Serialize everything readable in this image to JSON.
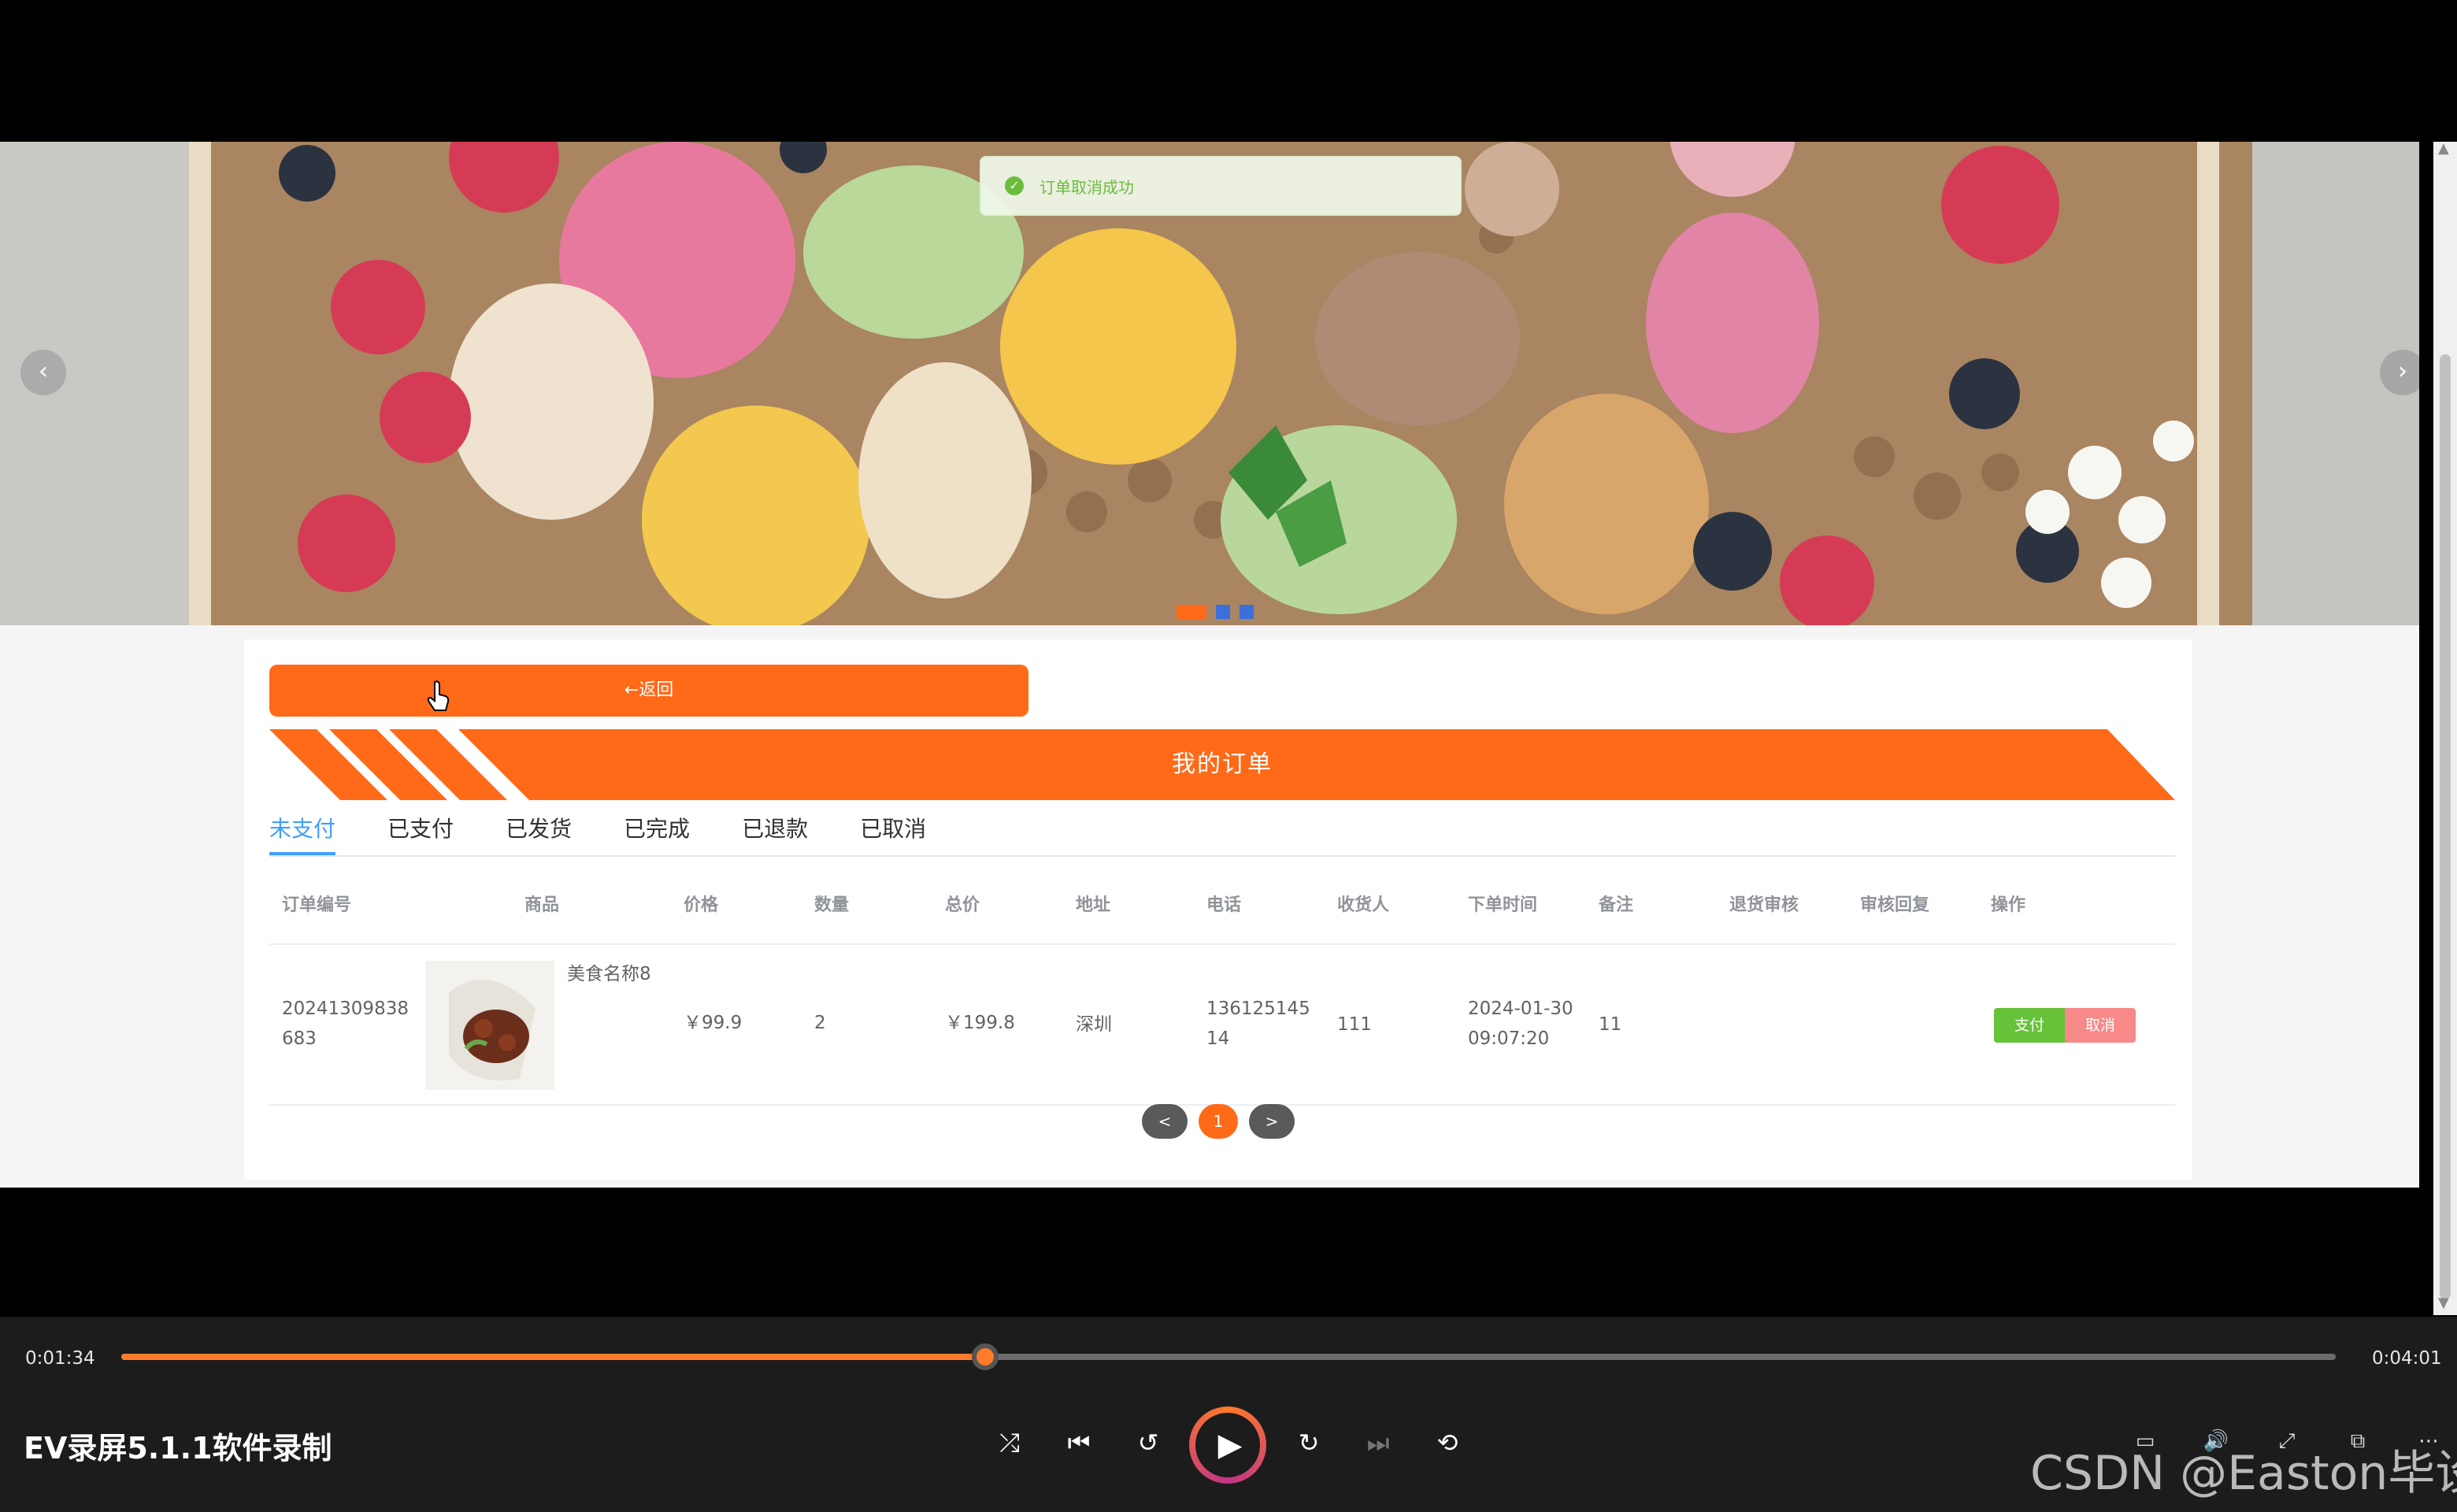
{
  "toast": {
    "message": "订单取消成功"
  },
  "banner": {
    "prev": "‹",
    "next": "›"
  },
  "card": {
    "back_label": "←返回",
    "title": "我的订单",
    "tabs": [
      "未支付",
      "已支付",
      "已发货",
      "已完成",
      "已退款",
      "已取消"
    ],
    "active_tab": "未支付",
    "columns": [
      "订单编号",
      "商品",
      "价格",
      "数量",
      "总价",
      "地址",
      "电话",
      "收货人",
      "下单时间",
      "备注",
      "退货审核",
      "审核回复",
      "操作"
    ],
    "rows": [
      {
        "order_no_1": "20241309838",
        "order_no_2": "683",
        "product_name": "美食名称8",
        "price": "￥99.9",
        "quantity": "2",
        "total": "￥199.8",
        "address": "深圳",
        "phone_1": "136125145",
        "phone_2": "14",
        "receiver": "111",
        "time_1": "2024-01-30",
        "time_2": "09:07:20",
        "remark": "11",
        "pay_label": "支付",
        "cancel_label": "取消"
      }
    ],
    "pager": {
      "prev": "<",
      "current": "1",
      "next": ">"
    }
  },
  "player": {
    "current_time": "0:01:34",
    "total_time": "0:04:01",
    "progress": 0.39,
    "title": "EV录屏5.1.1软件录制",
    "watermark": "CSDN @Easton毕设"
  },
  "colors": {
    "accent": "#ff6a18",
    "success": "#67c23a",
    "danger": "#f78989",
    "link": "#409eff"
  }
}
